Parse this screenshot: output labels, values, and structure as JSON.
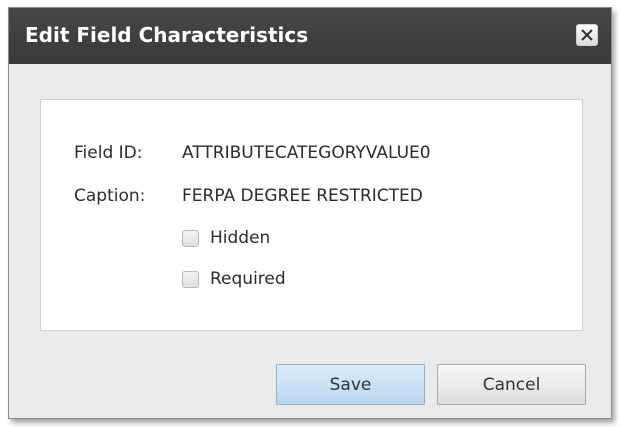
{
  "dialog": {
    "title": "Edit Field Characteristics",
    "close_icon": "close-icon",
    "fields": {
      "field_id_label": "Field ID:",
      "field_id_value": "ATTRIBUTECATEGORYVALUE0",
      "caption_label": "Caption:",
      "caption_value": "FERPA DEGREE RESTRICTED"
    },
    "checkboxes": {
      "hidden_label": "Hidden",
      "hidden_checked": false,
      "required_label": "Required",
      "required_checked": false
    },
    "buttons": {
      "save_label": "Save",
      "cancel_label": "Cancel"
    }
  }
}
